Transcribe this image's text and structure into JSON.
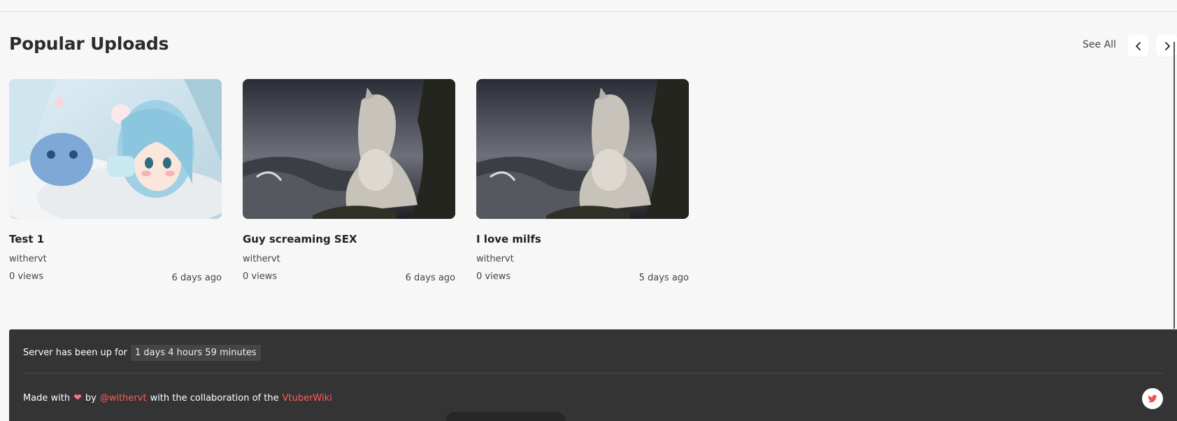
{
  "section": {
    "title": "Popular Uploads",
    "see_all": "See All"
  },
  "cards": [
    {
      "title": "Test 1",
      "author": "withervt",
      "views": "0 views",
      "age": "6 days ago",
      "thumbnail": "anime-girl-in-bed"
    },
    {
      "title": "Guy screaming SEX",
      "author": "withervt",
      "views": "0 views",
      "age": "6 days ago",
      "thumbnail": "wolf-by-stormy-sea"
    },
    {
      "title": "I love milfs",
      "author": "withervt",
      "views": "0 views",
      "age": "5 days ago",
      "thumbnail": "wolf-by-stormy-sea"
    }
  ],
  "footer": {
    "uptime_label": "Server has been up for",
    "uptime_value": "1 days 4 hours 59 minutes",
    "made_with": "Made with",
    "by": "by",
    "author_link": "@withervt",
    "collab_text": "with the collaboration of the",
    "collab_link": "VtuberWiki"
  },
  "colors": {
    "background": "#f7f7f7",
    "footer_bg": "#343434",
    "link": "#ff5b5b",
    "heart": "#f5768b",
    "twitter": "#ef5350"
  },
  "icons": {
    "prev": "chevron-left-icon",
    "next": "chevron-right-icon",
    "heart": "heart-icon",
    "social": "twitter-icon"
  }
}
